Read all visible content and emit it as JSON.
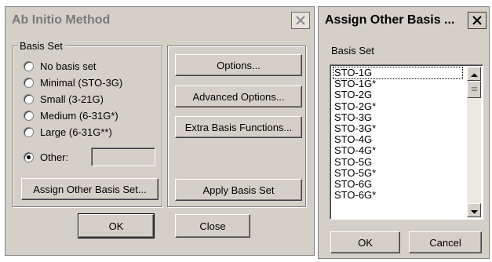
{
  "dialog_main": {
    "title": "Ab Initio Method",
    "basis_set_group_label": "Basis Set",
    "radios": [
      {
        "label": "No basis set",
        "checked": false
      },
      {
        "label": "Minimal (STO-3G)",
        "checked": false
      },
      {
        "label": "Small (3-21G)",
        "checked": false
      },
      {
        "label": "Medium (6-31G*)",
        "checked": false
      },
      {
        "label": "Large (6-31G**)",
        "checked": false
      },
      {
        "label": "Other:",
        "checked": true
      }
    ],
    "other_value": "",
    "buttons": {
      "options": "Options...",
      "advanced_options": "Advanced Options...",
      "extra_basis_functions": "Extra Basis Functions...",
      "assign_other_basis_set": "Assign Other Basis Set...",
      "apply_basis_set": "Apply Basis Set",
      "ok": "OK",
      "close": "Close"
    }
  },
  "dialog_assign": {
    "title": "Assign Other Basis ...",
    "list_label": "Basis Set",
    "items": [
      "STO-1G",
      "STO-1G*",
      "STO-2G",
      "STO-2G*",
      "STO-3G",
      "STO-3G*",
      "STO-4G",
      "STO-4G*",
      "STO-5G",
      "STO-5G*",
      "STO-6G",
      "STO-6G*"
    ],
    "focused_index": 0,
    "buttons": {
      "ok": "OK",
      "cancel": "Cancel"
    }
  },
  "icons": {
    "close": "close-icon",
    "scroll_up": "scroll-up-arrow-icon",
    "scroll_down": "scroll-down-arrow-icon"
  }
}
